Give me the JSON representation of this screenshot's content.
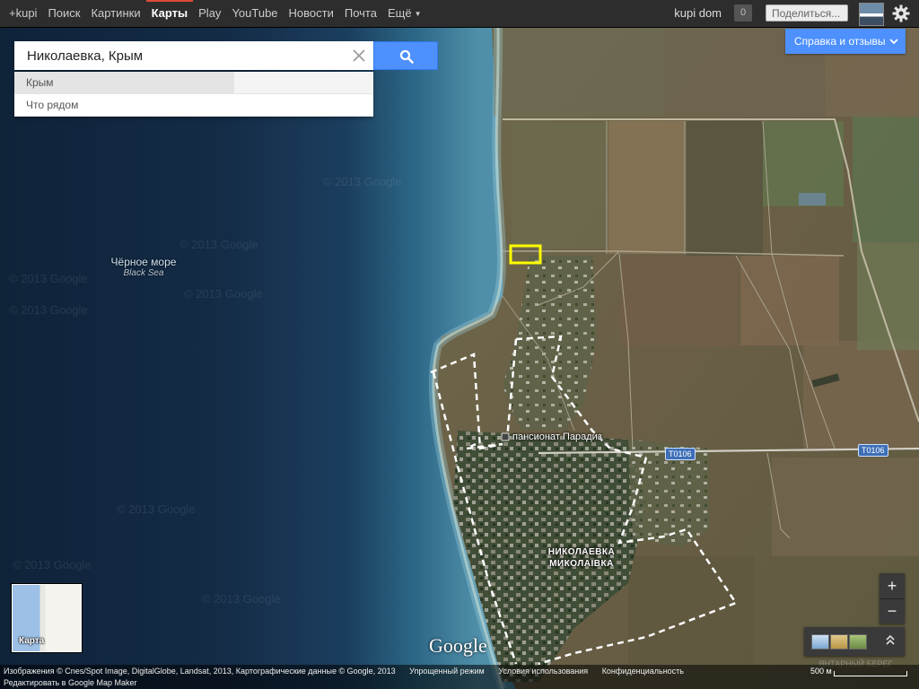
{
  "gbar": {
    "links": [
      {
        "label": "+kupi",
        "active": false
      },
      {
        "label": "Поиск",
        "active": false
      },
      {
        "label": "Картинки",
        "active": false
      },
      {
        "label": "Карты",
        "active": true
      },
      {
        "label": "Play",
        "active": false
      },
      {
        "label": "YouTube",
        "active": false
      },
      {
        "label": "Новости",
        "active": false
      },
      {
        "label": "Почта",
        "active": false
      },
      {
        "label": "Ещё",
        "active": false
      }
    ],
    "user": "kupi dom",
    "notifications": "0",
    "share_label": "Поделиться..."
  },
  "search": {
    "value": "Николаевка, Крым",
    "suggestions": [
      "Крым",
      "Что рядом"
    ]
  },
  "feedback_label": "Справка и отзывы",
  "map": {
    "water_ru": "Чёрное море",
    "water_en": "Black Sea",
    "watermark": "© 2013 Google",
    "poi": "пансионат Парадиз",
    "town_ru": "НИКОЛАЕВКА",
    "town_ua": "МИКОЛАЇВКА",
    "road": "T0106",
    "faint_place": "ЯНТАРНЫЙ БЕРЕГ",
    "logo": "Google"
  },
  "layer_label": "Карта",
  "zoom": {
    "in": "+",
    "out": "−"
  },
  "footer": {
    "attribution": "Изображения © Cnes/Spot Image, DigitalGlobe, Landsat, 2013, Картографические данные © Google, 2013",
    "lite_mode": "Упрощенный режим",
    "terms": "Условия использования",
    "privacy": "Конфиденциальность",
    "mapmaker": "Редактировать в Google Map Maker",
    "scale": "500 м"
  },
  "colors": {
    "accent": "#4d90fe",
    "active_tab": "#dd4b39",
    "highlight_box": "#ffff00"
  }
}
